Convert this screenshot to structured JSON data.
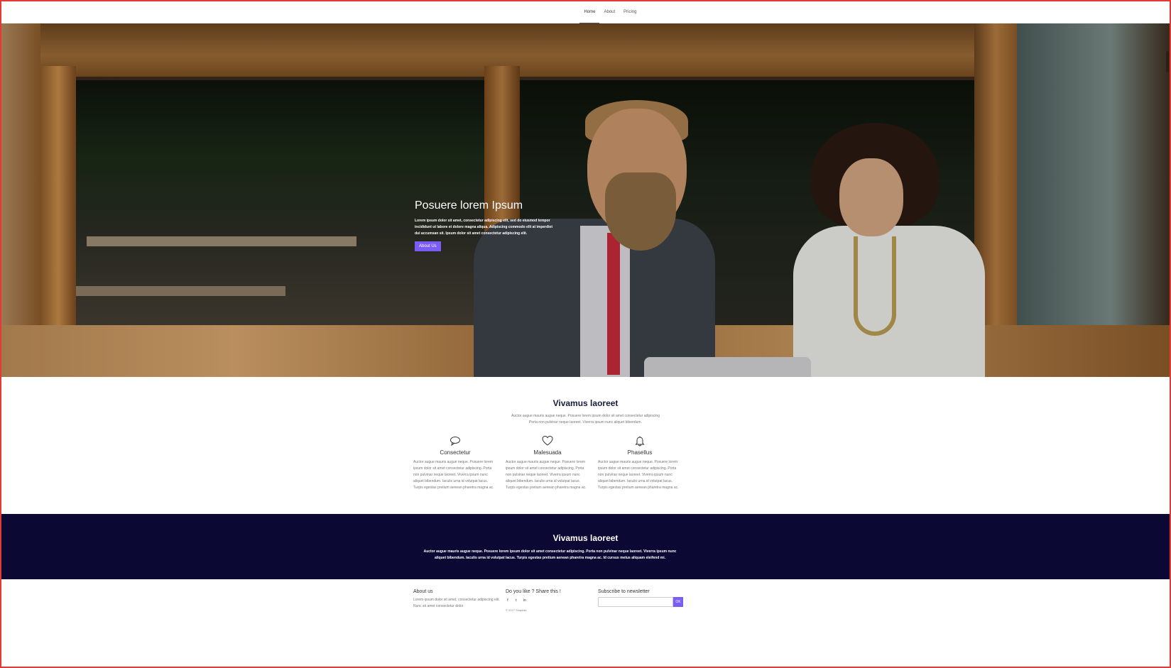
{
  "nav": {
    "items": [
      {
        "label": "Home",
        "active": true
      },
      {
        "label": "About",
        "active": false
      },
      {
        "label": "Pricing",
        "active": false
      }
    ]
  },
  "hero": {
    "title": "Posuere lorem Ipsum",
    "text": "Lorem ipsum dolor sit amet, consectetur adipiscing elit, sed do eiusmod tempor incididunt ut labore et dolore magna aliqua. Adipiscing commodo elit at imperdiet dui accumsan sit. Ipsum dolor sit amet consectetur adipiscing elit.",
    "button_label": "About Us"
  },
  "features": {
    "title": "Vivamus laoreet",
    "subtitle_line1": "Auctor augue mauris augue neque. Posuere lorem ipsum dolor sit amet consectetur adipiscing",
    "subtitle_line2": "Porta non pulvinar neque laoreet. Viverra ipsum nunc aliquet bibendum.",
    "items": [
      {
        "icon": "comment-icon",
        "title": "Consectetur",
        "text": "Auctor augue mauris augue neque. Posuere lorem ipsum dolor sit amet consectetur adipiscing. Porta non pulvinar neque laoreet. Viverra ipsum nunc aliquet bibendum. Iaculis urna id volutpat lacus. Turpis egestas pretium aenean pharetra magna ac."
      },
      {
        "icon": "heart-icon",
        "title": "Malesuada",
        "text": "Auctor augue mauris augue neque. Posuere lorem ipsum dolor sit amet consectetur adipiscing. Porta non pulvinar neque laoreet. Viverra ipsum nunc aliquet bibendum. Iaculis urna id volutpat lacus. Turpis egestas pretium aenean pharetra magna ac."
      },
      {
        "icon": "bell-icon",
        "title": "Phasellus",
        "text": "Auctor augue mauris augue neque. Posuere lorem ipsum dolor sit amet consectetur adipiscing. Porta non pulvinar neque laoreet. Viverra ipsum nunc aliquet bibendum. Iaculis urna id volutpat lacus. Turpis egestas pretium aenean pharetra magna ac."
      }
    ]
  },
  "band": {
    "title": "Vivamus laoreet",
    "text": "Auctor augue mauris augue neque. Posuere lorem ipsum dolor sit amet consectetur adipiscing. Porta non pulvinar neque laoreet. Viverra ipsum nunc aliquet bibendum. Iaculis urna id volutpat lacus. Turpis egestas pretium aenean pharetra magna ac. Id cursus metus aliquam eleifend mi."
  },
  "footer": {
    "about_title": "About us",
    "about_text": "Lorem ipsum dolor sit amet, consectetur adipiscing elit. Nunc sit amet consectetur dolor",
    "share_title": "Do you like ? Share this !",
    "social": [
      "f",
      "t",
      "in"
    ],
    "copyright": "© 2017 Shapilab",
    "newsletter_title": "Subscribe to newsletter",
    "newsletter_placeholder": "",
    "newsletter_button": "OK"
  },
  "colors": {
    "accent": "#7b5cf5",
    "band_bg": "#0b0833",
    "frame": "#e53935"
  }
}
